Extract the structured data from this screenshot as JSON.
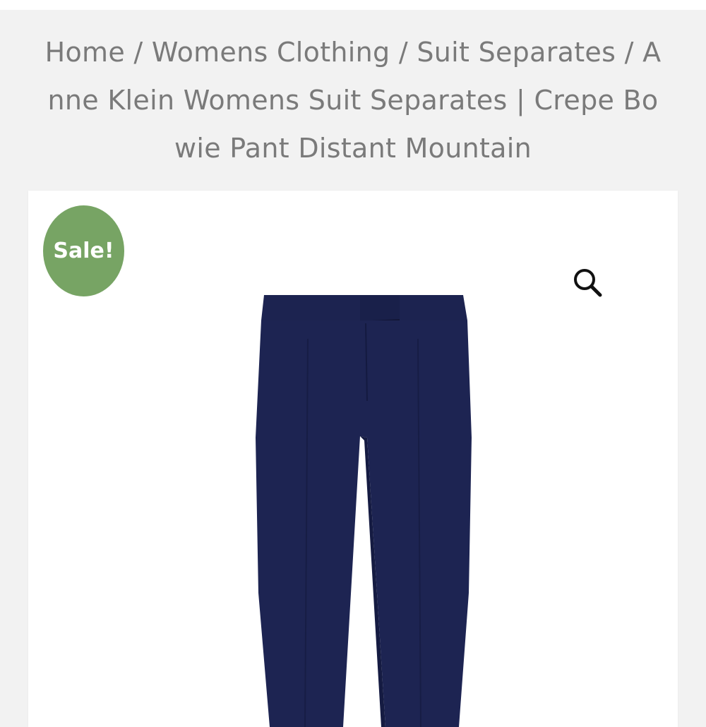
{
  "breadcrumb": {
    "items": [
      {
        "label": "Home"
      },
      {
        "label": "Womens Clothing"
      },
      {
        "label": "Suit Separates"
      }
    ],
    "current": "Anne Klein Womens Suit Separates | Crepe Bowie Pant Distant Mountain",
    "separator": " / "
  },
  "product": {
    "sale_badge": "Sale!",
    "badge_color": "#77a464",
    "zoom_icon": "search-icon",
    "image_icon": "navy-pants-image",
    "pants_color": "#1c2350"
  }
}
